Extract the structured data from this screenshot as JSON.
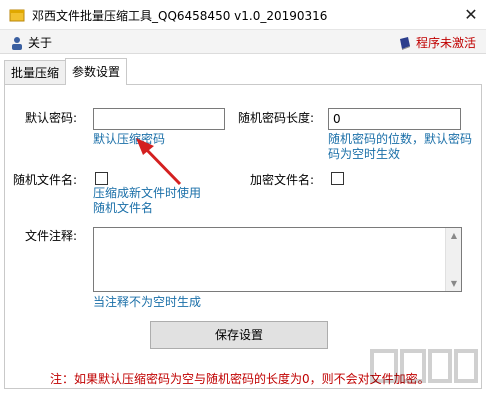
{
  "window": {
    "title": "邓西文件批量压缩工具_QQ6458450 v1.0_20190316",
    "close_glyph": "✕"
  },
  "menu": {
    "about_label": "关于",
    "register_label": "程序未激活"
  },
  "tabs": [
    {
      "label": "批量压缩",
      "active": false
    },
    {
      "label": "参数设置",
      "active": true
    }
  ],
  "settings": {
    "password_label": "默认密码:",
    "password_value": "",
    "password_hint": "默认压缩密码",
    "random_len_label": "随机密码长度:",
    "random_len_value": "0",
    "random_len_hint_1": "随机密码的位数，默认密码",
    "random_len_hint_2": "码为空时生效",
    "random_name_label": "随机文件名:",
    "random_name_checked": false,
    "random_name_hint_1": "压缩成新文件时使用",
    "random_name_hint_2": "随机文件名",
    "encrypt_name_label": "加密文件名:",
    "encrypt_name_checked": false,
    "comment_label": "文件注释:",
    "comment_value": "",
    "comment_hint": "当注释不为空时生成",
    "save_label": "保存设置",
    "note": "注：如果默认压缩密码为空与随机密码的长度为0，则不会对文件加密。"
  },
  "colors": {
    "hint_blue": "#1a6fa8",
    "warning_red": "#c00000",
    "arrow_red": "#d42020"
  }
}
